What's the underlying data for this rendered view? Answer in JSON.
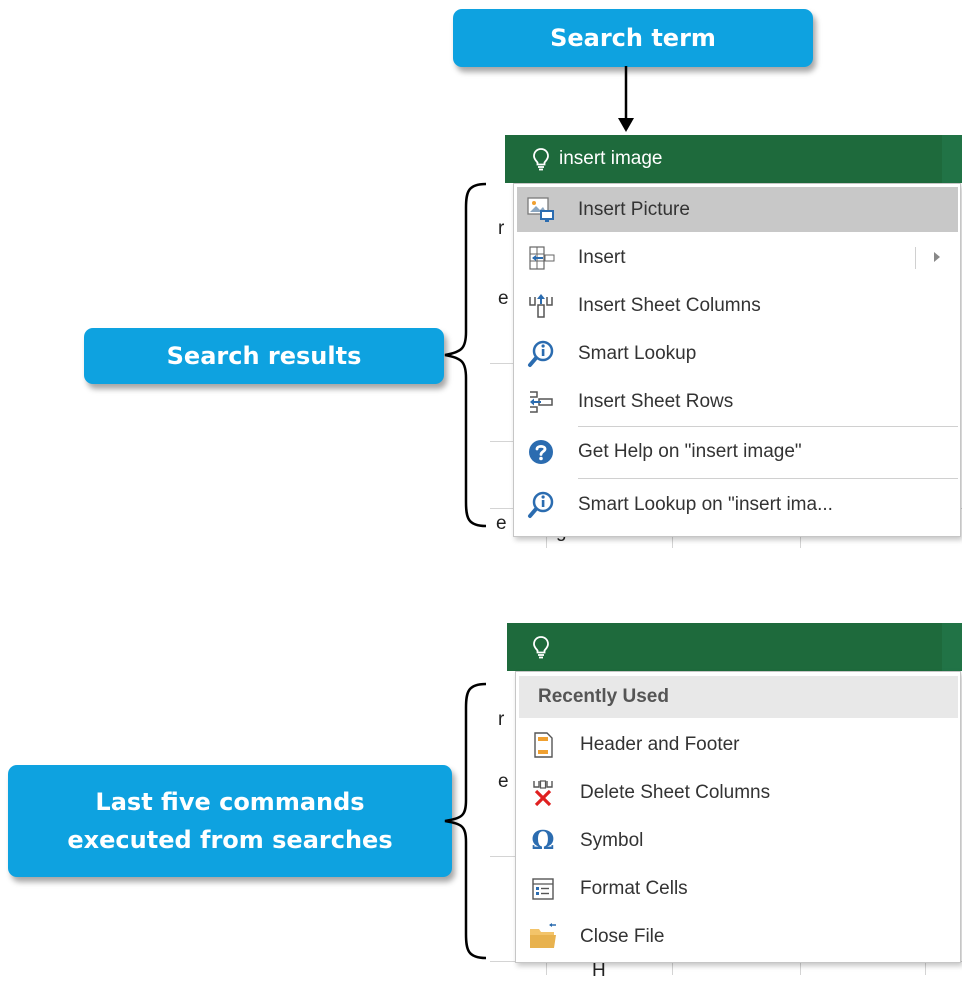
{
  "callouts": {
    "search_term": "Search term",
    "search_results": "Search results",
    "last_five_line1": "Last five commands",
    "last_five_line2": "executed from searches"
  },
  "top_panel": {
    "query": "insert image",
    "results": [
      {
        "label": "Insert Picture",
        "icon": "picture-icon",
        "highlighted": true
      },
      {
        "label": "Insert",
        "icon": "insert-cells-icon",
        "has_submenu": true
      },
      {
        "label": "Insert Sheet Columns",
        "icon": "insert-columns-icon"
      },
      {
        "label": "Smart Lookup",
        "icon": "smart-lookup-icon"
      },
      {
        "label": "Insert Sheet Rows",
        "icon": "insert-rows-icon"
      },
      {
        "label": "Get Help on \"insert image\"",
        "icon": "help-icon"
      },
      {
        "label": "Smart Lookup on \"insert ima...",
        "icon": "smart-lookup-icon"
      }
    ]
  },
  "bottom_panel": {
    "query": "",
    "section_header": "Recently Used",
    "items": [
      {
        "label": "Header and Footer",
        "icon": "header-footer-icon"
      },
      {
        "label": "Delete Sheet Columns",
        "icon": "delete-columns-icon"
      },
      {
        "label": "Symbol",
        "icon": "omega-icon"
      },
      {
        "label": "Format Cells",
        "icon": "format-cells-icon"
      },
      {
        "label": "Close File",
        "icon": "folder-icon"
      }
    ]
  },
  "colors": {
    "callout_blue": "#0ea2e0",
    "tellbar_green": "#1e6a3c",
    "highlight_gray": "#c8c8c8",
    "icon_blue": "#2b6cb0",
    "delete_red": "#e02020"
  }
}
